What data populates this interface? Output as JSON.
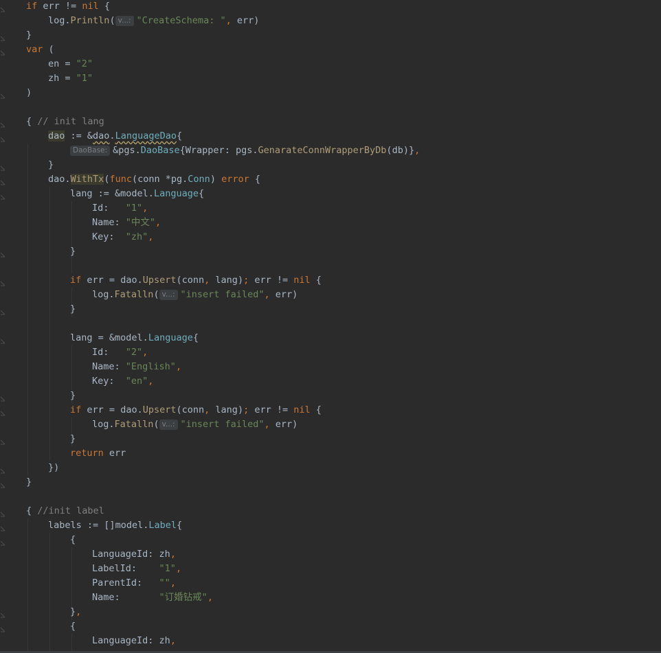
{
  "editor": {
    "language": "Go",
    "hints": {
      "v": "v...:",
      "daobase": "DaoBase:"
    },
    "lines": [
      {
        "id": "l1",
        "tokens": [
          [
            "kw",
            "if"
          ],
          [
            "t",
            " err "
          ],
          [
            "t",
            "!="
          ],
          [
            "t",
            " "
          ],
          [
            "kw",
            "nil"
          ],
          [
            "t",
            " {"
          ]
        ]
      },
      {
        "id": "l2"
      },
      {
        "id": "l3"
      },
      {
        "id": "l4"
      },
      {
        "id": "l5"
      },
      {
        "id": "l6"
      },
      {
        "id": "l7"
      }
    ],
    "text": {
      "if": "if",
      "err": "err",
      "nil": "nil",
      "log": "log",
      "println": "Println",
      "fatalln": "Fatalln",
      "createSchema": "\"CreateSchema: \"",
      "var": "var",
      "en": "en",
      "zh": "zh",
      "str2": "\"2\"",
      "str1": "\"1\"",
      "initLang": "// init lang",
      "dao": "dao",
      "languageDao": "LanguageDao",
      "pgs": "pgs",
      "daoBaseType": "DaoBase",
      "wrapper": "Wrapper",
      "genFn": "GenarateConnWrapperByDb",
      "db": "db",
      "withTx": "WithTx",
      "func": "func",
      "conn": "conn",
      "pg": "pg",
      "connType": "Conn",
      "error": "error",
      "lang": "lang",
      "model": "model",
      "language": "Language",
      "id": "Id",
      "name": "Name",
      "key": "Key",
      "zhName": "\"中文\"",
      "zhKey": "\"zh\"",
      "upsert": "Upsert",
      "insertFailed": "\"insert failed\"",
      "english": "\"English\"",
      "enKey": "\"en\"",
      "return": "return",
      "initLabel": "//init label",
      "labels": "labels",
      "label": "Label",
      "languageId": "LanguageId",
      "labelId": "LabelId",
      "parentId": "ParentId",
      "emptyStr": "\"\"",
      "ringName": "\"订婚钻戒\""
    }
  },
  "colors": {
    "background": "#2b2b2b",
    "keyword": "#cc7832",
    "string": "#6a8759",
    "comment": "#808080",
    "function": "#ffc66d",
    "text": "#a9b7c6",
    "type": "#6fafbd"
  }
}
